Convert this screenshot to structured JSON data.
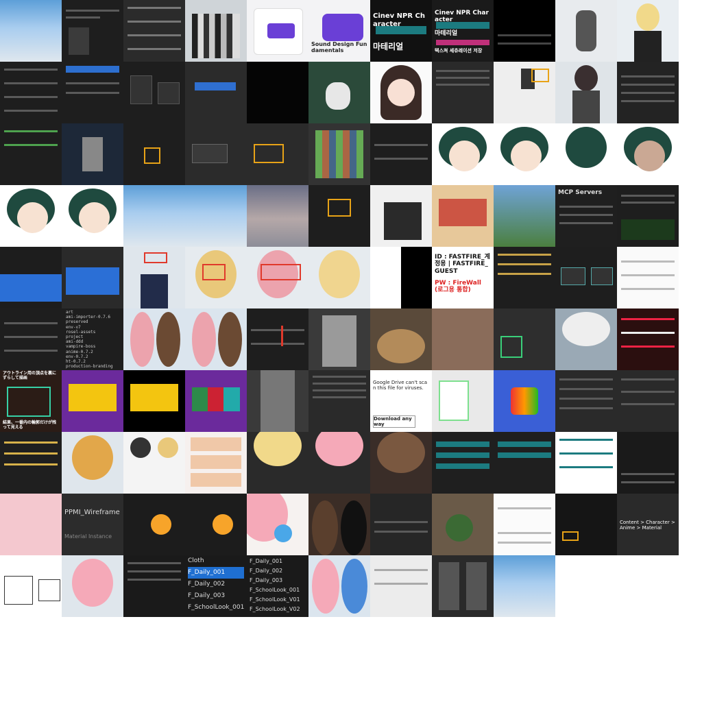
{
  "tiles": [
    {
      "id": "r1c1"
    },
    {
      "id": "r1c2"
    },
    {
      "id": "r1c3"
    },
    {
      "id": "r1c4"
    },
    {
      "id": "r1c5",
      "label": "Sound Design Fundamentals"
    },
    {
      "id": "r1c6",
      "label": "Sound Design Fundamentals"
    },
    {
      "id": "r1c7",
      "label": "Cinev NPR Character",
      "sub": "마테리얼"
    },
    {
      "id": "r1c8",
      "label": "Cinev NPR Character",
      "sub": "마테리얼",
      "sub2": "텍스쳐 세츄레이션 저장"
    },
    {
      "id": "r1c9"
    },
    {
      "id": "r1c10"
    },
    {
      "id": "r1c11"
    },
    {
      "id": "r4c10",
      "label": "MCP Servers"
    },
    {
      "id": "r5c8",
      "label": "ID : FASTFIRE_계정용 | FASTFIRE_GUEST",
      "sub": "PW : FireWall (로그용 통합)"
    },
    {
      "id": "r6c2",
      "list": [
        "art",
        "ami-importer-0.7.6",
        "preserved",
        "env-v7",
        "rosel-assets",
        "project",
        "ami-ddd",
        "vampire-boss",
        "anime-0.7.2",
        "env-0.7.2",
        "ht-0.7.2",
        "production-branding"
      ]
    },
    {
      "id": "r7c1",
      "label": "アウトライン用の頂点を裏にずらして描画",
      "sub": "結果、一番内の輪郭だけが残って見える"
    },
    {
      "id": "r7c7",
      "label": "Google Drive can't scan this file for viruses.",
      "sub": "Download anyway"
    },
    {
      "id": "r9c2",
      "label": "PPMI_Wireframe",
      "sub": "Material Instance"
    },
    {
      "id": "r9c10",
      "label": "Content > Character > Anime > Material"
    },
    {
      "id": "r10c4",
      "list": [
        "Cloth",
        "F_Daily_001",
        "F_Daily_002",
        "F_Daily_003",
        "F_SchoolLook_001"
      ]
    },
    {
      "id": "r10c5",
      "list": [
        "F_Daily_001",
        "F_Daily_002",
        "F_Daily_003",
        "F_SchoolLook_001",
        "F_SchoolLook_V01",
        "F_SchoolLook_V02"
      ]
    }
  ],
  "colors": {
    "accent": "#e8a317",
    "highlight": "#1f6fd1",
    "ue_dark": "#1e1e1e"
  }
}
